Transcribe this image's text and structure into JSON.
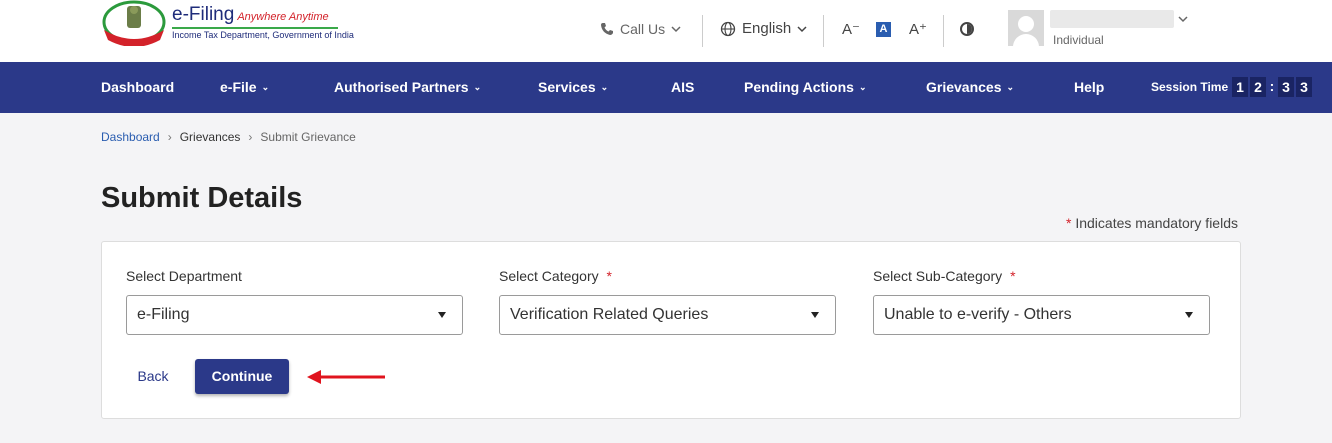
{
  "header": {
    "logo_title": "e-Filing",
    "logo_tagline": "Anywhere Anytime",
    "logo_subtitle": "Income Tax Department, Government of India",
    "call_us": "Call Us",
    "language": "English",
    "font_decrease": "A⁻",
    "font_default": "A",
    "font_increase": "A⁺",
    "user_role": "Individual"
  },
  "nav": {
    "items": [
      {
        "label": "Dashboard"
      },
      {
        "label": "e-File"
      },
      {
        "label": "Authorised Partners"
      },
      {
        "label": "Services"
      },
      {
        "label": "AIS"
      },
      {
        "label": "Pending Actions"
      },
      {
        "label": "Grievances"
      },
      {
        "label": "Help"
      }
    ],
    "session_label": "Session Time",
    "session_digits": [
      "1",
      "2",
      "3",
      "3"
    ]
  },
  "breadcrumb": {
    "items": [
      "Dashboard",
      "Grievances",
      "Submit Grievance"
    ]
  },
  "page": {
    "title": "Submit Details",
    "mandatory_star": "*",
    "mandatory_note": "Indicates mandatory fields"
  },
  "form": {
    "department": {
      "label": "Select Department",
      "value": "e-Filing",
      "required": false
    },
    "category": {
      "label": "Select Category",
      "value": "Verification Related Queries",
      "required": true
    },
    "subcategory": {
      "label": "Select Sub-Category",
      "value": "Unable to e-verify - Others",
      "required": true
    },
    "back_label": "Back",
    "continue_label": "Continue"
  },
  "colors": {
    "brand": "#2b3989",
    "required": "#d3222a",
    "annotation_arrow": "#e0141e"
  }
}
